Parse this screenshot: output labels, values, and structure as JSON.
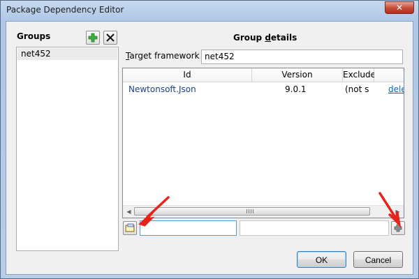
{
  "window": {
    "title": "Package Dependency Editor",
    "close_glyph": "✕"
  },
  "groups": {
    "label": "Groups",
    "items": [
      {
        "name": "net452"
      }
    ],
    "add_icon": "plus-icon",
    "remove_icon": "x-icon"
  },
  "details": {
    "label": "Group details",
    "target_framework_label": "Target framework",
    "target_framework_value": "net452"
  },
  "grid": {
    "columns": [
      "Id",
      "Version",
      "Exclude"
    ],
    "rows": [
      {
        "id": "Newtonsoft.Json",
        "version": "9.0.1",
        "exclude": "(not s",
        "action": "dele"
      }
    ],
    "scrollbar_grip": "|||"
  },
  "add_row": {
    "browse_icon": "browse-icon",
    "add_icon": "plus-icon",
    "id_value": "",
    "version_value": ""
  },
  "buttons": {
    "ok": "OK",
    "cancel": "Cancel"
  },
  "colors": {
    "link": "#0066cc",
    "annotation_arrow": "#e8231c",
    "plus_green": "#3cae3c"
  }
}
